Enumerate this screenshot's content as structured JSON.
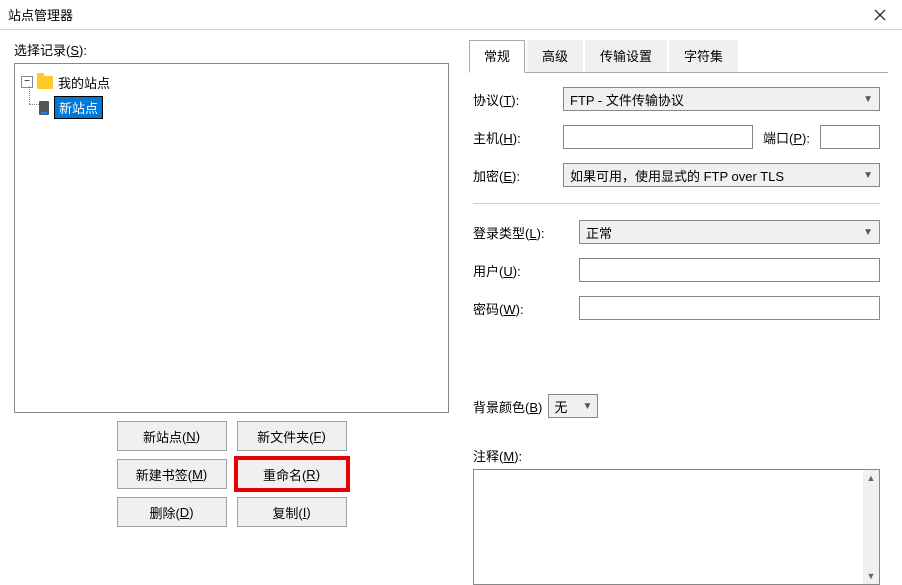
{
  "window": {
    "title": "站点管理器"
  },
  "left": {
    "select_label": "选择记录(S):",
    "tree": {
      "root_label": "我的站点",
      "child_label": "新站点"
    },
    "buttons": {
      "new_site": "新站点(N)",
      "new_folder": "新文件夹(F)",
      "new_bookmark": "新建书签(M)",
      "rename": "重命名(R)",
      "delete": "删除(D)",
      "copy": "复制(I)"
    }
  },
  "tabs": {
    "general": "常规",
    "advanced": "高级",
    "transfer": "传输设置",
    "charset": "字符集"
  },
  "form": {
    "protocol_label": "协议(T):",
    "protocol_value": "FTP - 文件传输协议",
    "host_label": "主机(H):",
    "port_label": "端口(P):",
    "encryption_label": "加密(E):",
    "encryption_value": "如果可用，使用显式的 FTP over TLS",
    "logon_type_label": "登录类型(L):",
    "logon_type_value": "正常",
    "user_label": "用户(U):",
    "password_label": "密码(W):",
    "bgcolor_label": "背景颜色(B)",
    "bgcolor_value": "无",
    "notes_label": "注释(M):"
  }
}
